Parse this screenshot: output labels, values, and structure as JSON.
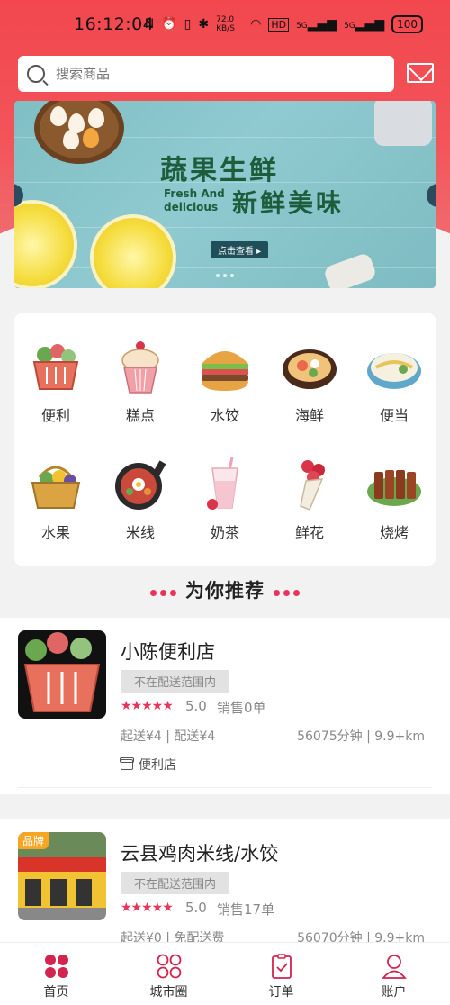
{
  "status_bar": {
    "time": "16:12:04",
    "speed": "72.0 KB/S",
    "battery": "100",
    "signal1": "5G",
    "signal2": "5G",
    "hd": "HD"
  },
  "search": {
    "placeholder": "搜索商品"
  },
  "banner": {
    "title_line1": "蔬果生鲜",
    "title_en": "Fresh And delicious",
    "title_line2": "新鲜美味",
    "cta": "点击查看 ▸"
  },
  "categories": [
    {
      "label": "便利",
      "icon": "basket-icon"
    },
    {
      "label": "糕点",
      "icon": "cupcake-icon"
    },
    {
      "label": "水饺",
      "icon": "burger-icon"
    },
    {
      "label": "海鲜",
      "icon": "seafood-pot-icon"
    },
    {
      "label": "便当",
      "icon": "bento-icon"
    },
    {
      "label": "水果",
      "icon": "fruit-basket-icon"
    },
    {
      "label": "米线",
      "icon": "noodle-pan-icon"
    },
    {
      "label": "奶茶",
      "icon": "milk-tea-icon"
    },
    {
      "label": "鲜花",
      "icon": "flower-bouquet-icon"
    },
    {
      "label": "烧烤",
      "icon": "bbq-skewer-icon"
    }
  ],
  "recommend": {
    "title": "为你推荐"
  },
  "shops": [
    {
      "name": "小陈便利店",
      "tag": "不在配送范围内",
      "stars": "★★★★★",
      "rating": "5.0",
      "sales": "销售0单",
      "fee": "起送¥4 | 配送¥4",
      "distance": "56075分钟 | 9.9+km",
      "category": "便利店",
      "brand": ""
    },
    {
      "name": "云县鸡肉米线/水饺",
      "tag": "不在配送范围内",
      "stars": "★★★★★",
      "rating": "5.0",
      "sales": "销售17单",
      "fee": "起送¥0 | 免配送费",
      "distance": "56070分钟 | 9.9+km",
      "category": "",
      "brand": "品牌"
    }
  ],
  "tabs": [
    {
      "label": "首页",
      "icon": "home-grid-icon"
    },
    {
      "label": "城市圈",
      "icon": "city-circle-icon"
    },
    {
      "label": "订单",
      "icon": "order-clipboard-icon"
    },
    {
      "label": "账户",
      "icon": "account-person-icon"
    }
  ],
  "colors": {
    "accent": "#e9345a",
    "header_red": "#f2474e"
  }
}
